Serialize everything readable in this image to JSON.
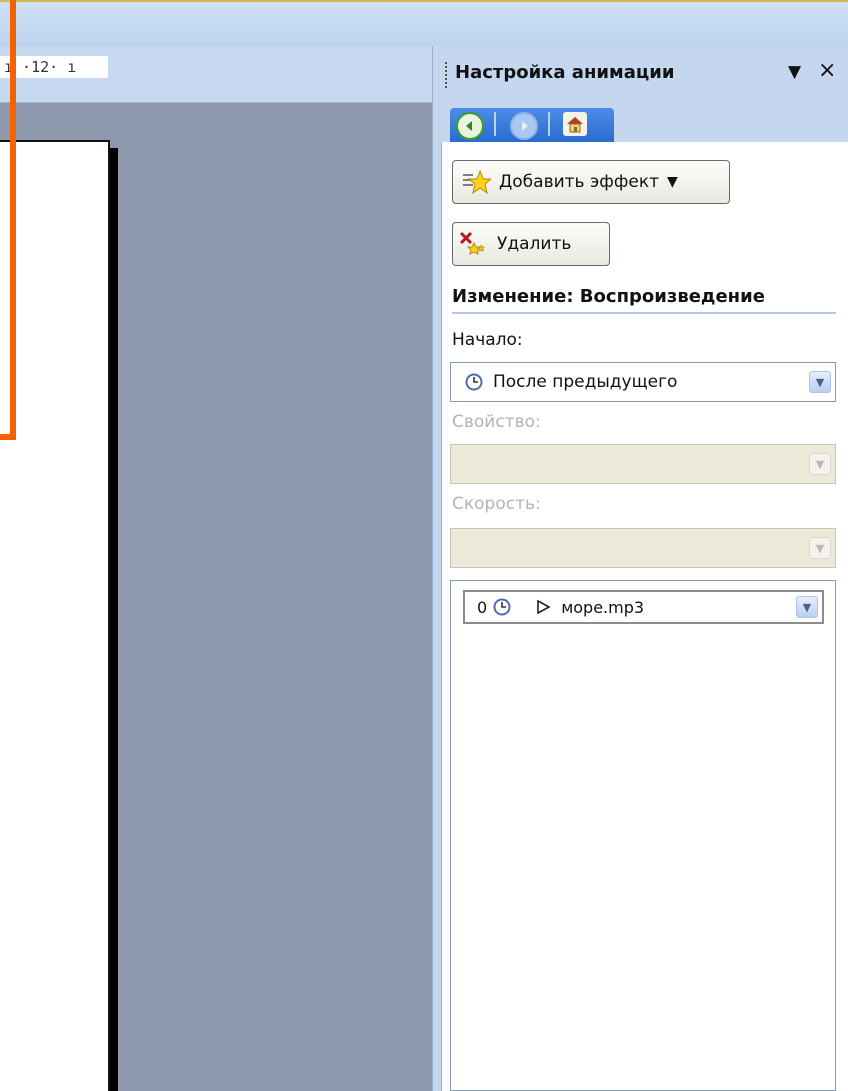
{
  "ruler": {
    "text": "ı ·12· ı"
  },
  "pane": {
    "title": "Настройка анимации",
    "dropdown_glyph": "▼",
    "close_glyph": "×"
  },
  "nav": {
    "back_icon": "back-arrow-icon",
    "forward_icon": "forward-arrow-icon",
    "home_icon": "home-icon"
  },
  "buttons": {
    "add_effect": "Добавить эффект",
    "add_effect_arrow": "▼",
    "delete": "Удалить"
  },
  "modify": {
    "title": "Изменение: Воспроизведение",
    "start_label": "Начало:",
    "start_value": "После предыдущего",
    "property_label": "Свойство:",
    "property_value": "",
    "speed_label": "Скорость:",
    "speed_value": ""
  },
  "effects_list": [
    {
      "order": "0",
      "name": "море.mp3"
    }
  ],
  "colors": {
    "accent_orange": "#f26200",
    "pane_blue": "#c4d7ef",
    "nav_blue": "#2a6bd0",
    "workspace": "#8f99ae"
  }
}
